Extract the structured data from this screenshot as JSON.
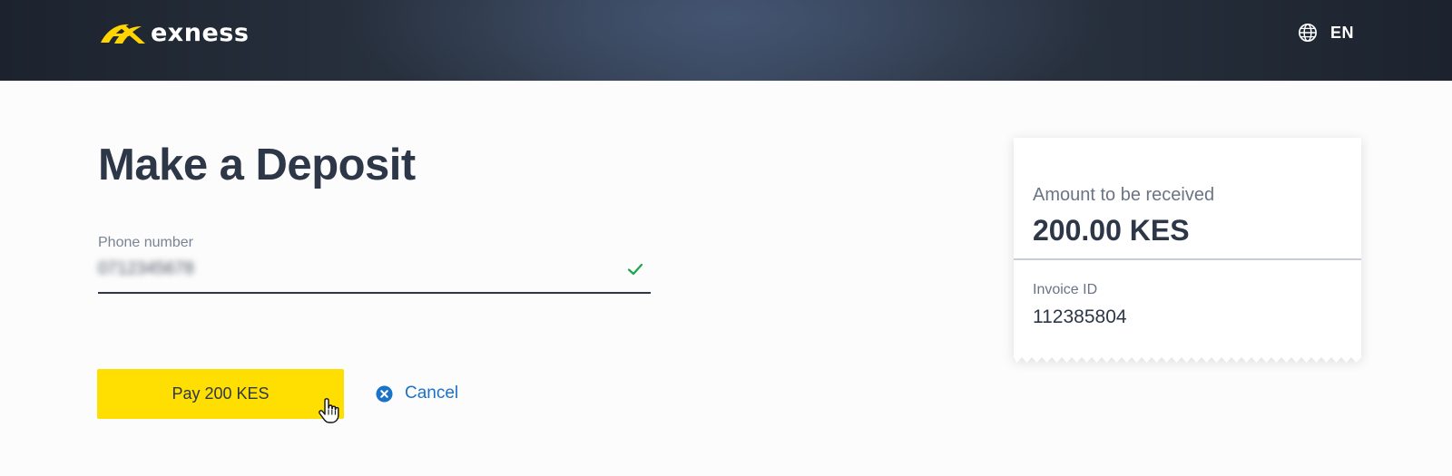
{
  "header": {
    "brand": "exness",
    "language": "EN"
  },
  "main": {
    "title": "Make a Deposit",
    "phone_field": {
      "label": "Phone number",
      "value": "0712345678",
      "valid": true
    },
    "pay_button_label": "Pay 200 KES",
    "cancel_label": "Cancel"
  },
  "summary": {
    "amount_label": "Amount to be received",
    "amount_value": "200.00 KES",
    "invoice_label": "Invoice ID",
    "invoice_value": "112385804"
  },
  "colors": {
    "brand_yellow": "#ffde02",
    "header_bg": "#2b3442",
    "text_dark": "#2d3748",
    "link_blue": "#1a73c8",
    "success_green": "#1aa64a"
  },
  "icons": {
    "brand": "exness-logo-icon",
    "language": "globe-icon",
    "valid": "check-icon",
    "cancel": "close-circle-icon",
    "pointer": "hand-pointer-icon"
  }
}
